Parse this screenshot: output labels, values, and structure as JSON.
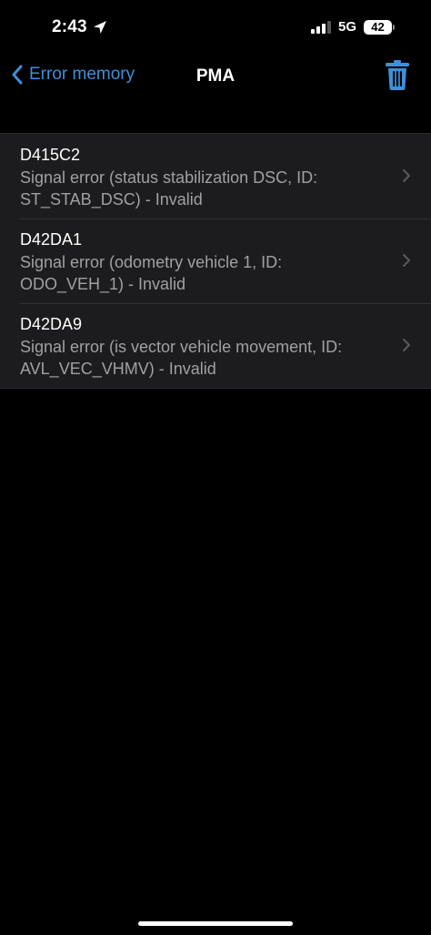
{
  "status_bar": {
    "time": "2:43",
    "network": "5G",
    "battery": "42",
    "icons": {
      "location": "location-arrow-icon",
      "signal": "cellular-signal-icon",
      "battery": "battery-icon"
    }
  },
  "nav": {
    "back_label": "Error memory",
    "title": "PMA",
    "icons": {
      "back": "chevron-left-icon",
      "trash": "trash-icon"
    }
  },
  "errors": [
    {
      "code": "D415C2",
      "line1": "Signal error (status stabilization DSC, ID:",
      "line2": "ST_STAB_DSC) - Invalid"
    },
    {
      "code": "D42DA1",
      "line1": "Signal error (odometry vehicle 1, ID:",
      "line2": "ODO_VEH_1) - Invalid"
    },
    {
      "code": "D42DA9",
      "line1": "Signal error (is vector vehicle movement, ID:",
      "line2": "AVL_VEC_VHMV) - Invalid"
    }
  ],
  "colors": {
    "accent": "#3f8fd9",
    "background": "#000000",
    "row_background": "#1c1c1e",
    "secondary_text": "#a0a0a5"
  }
}
